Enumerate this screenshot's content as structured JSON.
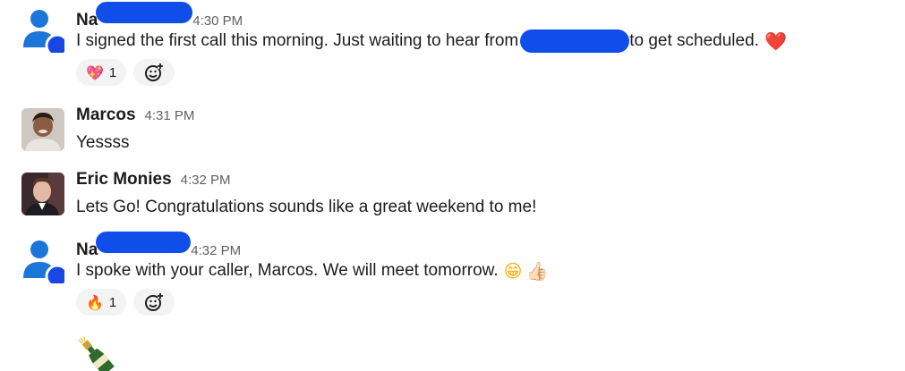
{
  "messages": [
    {
      "name": "Na",
      "time": "4:30 PM",
      "text_before": "I signed the first call this morning. Just waiting to hear from",
      "text_after": "to get scheduled.",
      "trailing_emoji": "❤️",
      "reactions": [
        {
          "emoji": "💖",
          "count": "1"
        }
      ]
    },
    {
      "name": "Marcos",
      "time": "4:31 PM",
      "text": "Yessss"
    },
    {
      "name": "Eric Monies",
      "time": "4:32 PM",
      "text": "Lets Go! Congratulations sounds like a great weekend to me!"
    },
    {
      "name": "Na",
      "time": "4:32 PM",
      "text": "I spoke with your caller, Marcos. We will meet tomorrow.",
      "emoji_1": "😁",
      "emoji_2": "👍🏻",
      "reactions": [
        {
          "emoji": "🔥",
          "count": "1"
        }
      ]
    }
  ],
  "icons": {
    "add_reaction": "add-reaction-icon",
    "generic_avatar": "person-avatar-icon",
    "bottle": "champagne-bottle-emoji"
  },
  "colors": {
    "redaction": "#0f4ee8",
    "avatar_blue": "#1c75d8",
    "avatar_badge": "#1847e6",
    "reaction_bg": "#f3f3f3"
  }
}
